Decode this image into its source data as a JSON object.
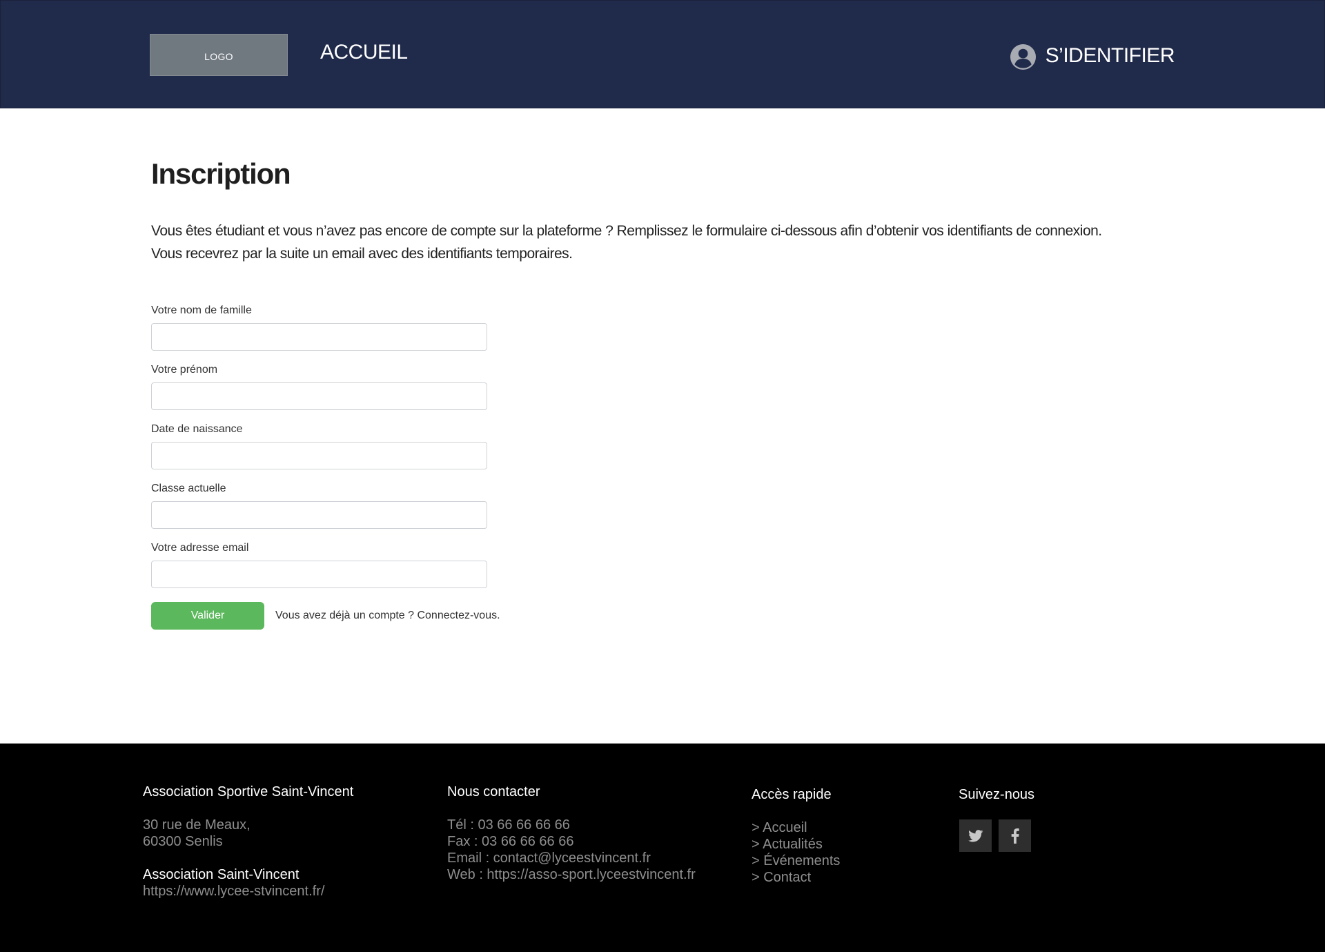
{
  "header": {
    "logo": "LOGO",
    "nav_home": "ACCUEIL",
    "login": "S’IDENTIFIER"
  },
  "main": {
    "title": "Inscription",
    "intro_line1": "Vous êtes étudiant et vous n’avez pas encore de compte sur la plateforme ? Remplissez le formulaire ci-dessous afin d’obtenir vos identifiants de connexion.",
    "intro_line2": "Vous recevrez par la suite un email avec des identifiants temporaires."
  },
  "form": {
    "fields": [
      {
        "label": "Votre nom de famille",
        "value": ""
      },
      {
        "label": "Votre prénom",
        "value": ""
      },
      {
        "label": "Date de naissance",
        "value": ""
      },
      {
        "label": "Classe actuelle",
        "value": ""
      },
      {
        "label": "Votre adresse email",
        "value": ""
      }
    ],
    "submit": "Valider",
    "login_link": "Vous avez déjà un compte ? Connectez-vous."
  },
  "footer": {
    "col1": {
      "heading": "Association Sportive Saint-Vincent",
      "address1": "30 rue de Meaux,",
      "address2": "60300 Senlis",
      "org": "Association Saint-Vincent",
      "url": "https://www.lycee-stvincent.fr/"
    },
    "col2": {
      "heading": "Nous contacter",
      "tel": "Tél : 03 66 66 66 66",
      "fax": "Fax : 03 66 66 66 66",
      "email": "Email : contact@lyceestvincent.fr",
      "web": "Web : https://asso-sport.lyceestvincent.fr"
    },
    "col3": {
      "heading": "Accès rapide",
      "links": [
        "> Accueil",
        "> Actualités",
        "> Événements",
        "> Contact"
      ]
    },
    "col4": {
      "heading": "Suivez-nous",
      "icons": [
        "twitter-icon",
        "facebook-icon"
      ]
    }
  },
  "colors": {
    "header_bg": "#202a4a",
    "submit_bg": "#5cb85c",
    "footer_bg": "#000000"
  }
}
